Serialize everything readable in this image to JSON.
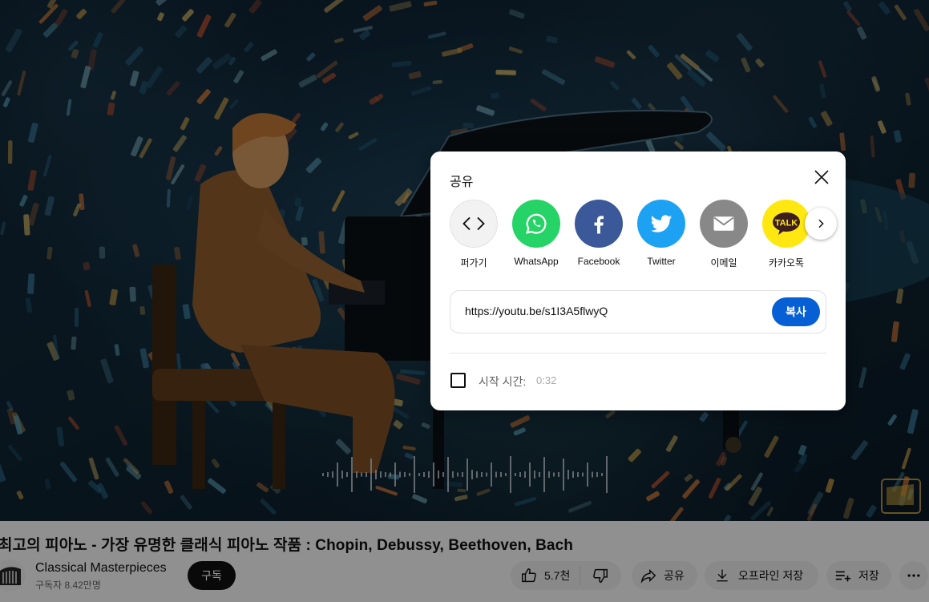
{
  "share_dialog": {
    "title": "공유",
    "targets": [
      {
        "label": "퍼가기",
        "icon": "embed-icon",
        "color": "#f2f2f2"
      },
      {
        "label": "WhatsApp",
        "icon": "whatsapp-icon",
        "color": "#25d366"
      },
      {
        "label": "Facebook",
        "icon": "facebook-icon",
        "color": "#3b5998"
      },
      {
        "label": "Twitter",
        "icon": "twitter-icon",
        "color": "#1da1f2"
      },
      {
        "label": "이메일",
        "icon": "email-icon",
        "color": "#888888"
      },
      {
        "label": "카카오톡",
        "icon": "kakaotalk-icon",
        "color": "#ffe812"
      }
    ],
    "url": "https://youtu.be/s1I3A5flwyQ",
    "copy_label": "복사",
    "start_time_label": "시작 시간:",
    "start_time_value": "0:32",
    "start_time_checked": false
  },
  "video": {
    "title": "최고의 피아노 - 가장 유명한 클래식 피아노 작품 : Chopin, Debussy, Beethoven, Bach",
    "channel": "Classical Masterpieces",
    "subscribers": "구독자 8.42만명",
    "subscribe_label": "구독",
    "likes": "5.7천",
    "share_label": "공유",
    "offline_label": "오프라인 저장",
    "save_label": "저장"
  },
  "colors": {
    "accent_blue": "#065fd4",
    "dark_button": "#0f0f0f"
  }
}
